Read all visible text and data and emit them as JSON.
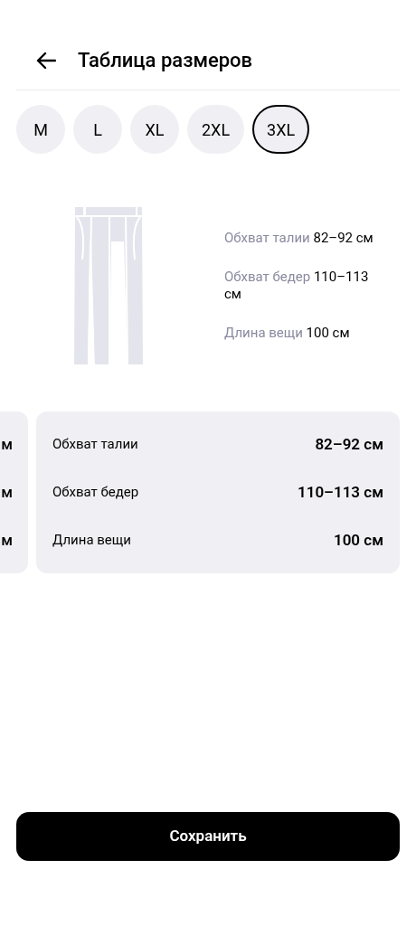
{
  "header": {
    "title": "Таблица размеров"
  },
  "sizes": [
    {
      "label": "M",
      "selected": false
    },
    {
      "label": "L",
      "selected": false
    },
    {
      "label": "XL",
      "selected": false
    },
    {
      "label": "2XL",
      "selected": false
    },
    {
      "label": "3XL",
      "selected": true
    }
  ],
  "summary": [
    {
      "label": "Обхват талии",
      "value": "82–92 см"
    },
    {
      "label": "Обхват бедер",
      "value": "110–113 см"
    },
    {
      "label": "Длина вещи",
      "value": "100 см"
    }
  ],
  "previous_card": {
    "rows": [
      "м",
      "м",
      "м"
    ]
  },
  "card": {
    "rows": [
      {
        "label": "Обхват талии",
        "value": "82–92 см"
      },
      {
        "label": "Обхват бедер",
        "value": "110–113 см"
      },
      {
        "label": "Длина вещи",
        "value": "100 см"
      }
    ]
  },
  "save_button": "Сохранить"
}
